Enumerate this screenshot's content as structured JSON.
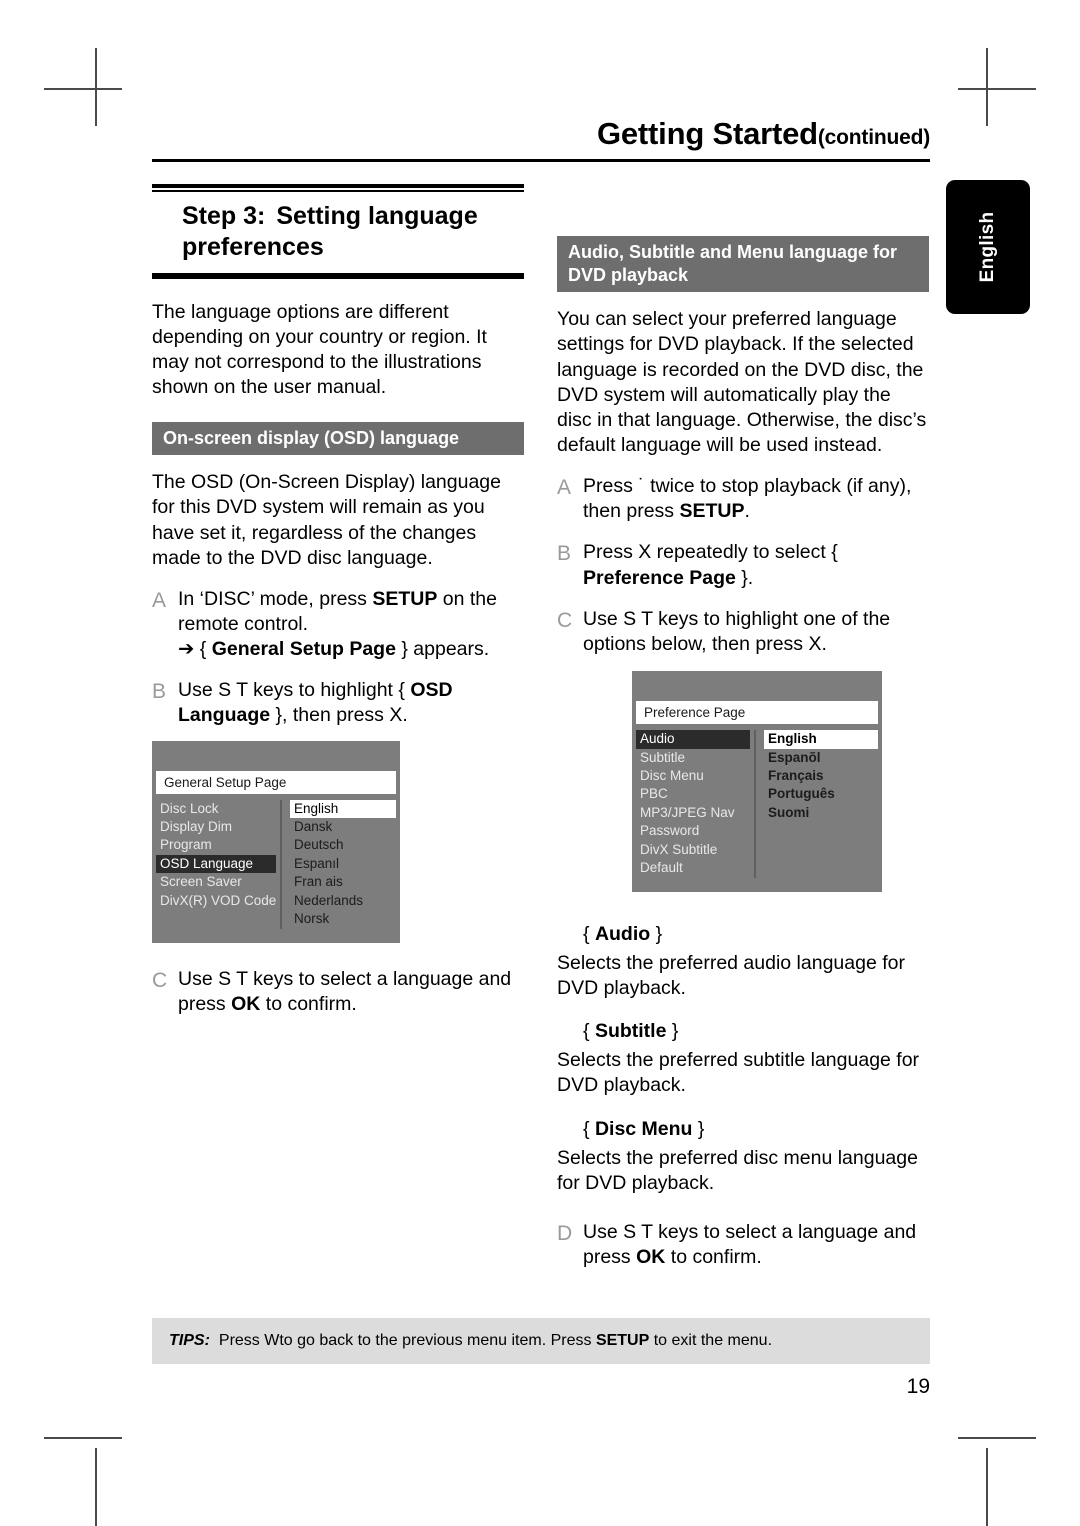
{
  "header": {
    "title": "Getting Started",
    "continued": "(continued)"
  },
  "side_tab": {
    "label": "English"
  },
  "left_column": {
    "step_title": {
      "number": "Step 3:",
      "text": "Setting language preferences"
    },
    "intro": "The language options are different depending on your country or region.  It may not correspond to the illustrations shown on the user manual.",
    "section_heading": "On-screen display (OSD) language",
    "section_body": "The OSD (On-Screen Display) language for this DVD system will remain as you have set it, regardless of the changes made to the DVD disc language.",
    "steps": [
      {
        "letter": "A",
        "line1_pre": "In ‘DISC’ mode, press ",
        "line1_bold": "SETUP",
        "line1_post": " on the remote control.",
        "arrow": "➔",
        "arrow_pre": " { ",
        "arrow_bold": "General Setup Page",
        "arrow_post": " } appears."
      },
      {
        "letter": "B",
        "pre": "Use  S T keys to highlight { ",
        "bold": "OSD Language",
        "post": " }, then press  X."
      },
      {
        "letter": "C",
        "pre": "Use  S T keys to select a language and press ",
        "bold": "OK",
        "post": " to confirm."
      }
    ],
    "osd_screen": {
      "title": "General Setup Page",
      "menu_items": [
        "Disc Lock",
        "Display Dim",
        "Program",
        "OSD Language",
        "Screen Saver",
        "DivX(R) VOD Code"
      ],
      "selected_menu_item": "OSD Language",
      "options": [
        "English",
        "Dansk",
        "Deutsch",
        "Espanıl",
        "Fran ais",
        "Nederlands",
        "Norsk"
      ],
      "selected_option": "English"
    }
  },
  "right_column": {
    "section_heading": "Audio, Subtitle and Menu language for DVD playback",
    "section_body": "You can select your preferred language settings for DVD playback.  If the selected language is recorded on the DVD disc, the DVD system will automatically play the disc in that language.  Otherwise, the disc’s default language will be used instead.",
    "steps": [
      {
        "letter": "A",
        "pre": "Press ˙   twice to stop playback (if any), then press ",
        "bold": "SETUP",
        "post": "."
      },
      {
        "letter": "B",
        "pre": "Press  X repeatedly to select { ",
        "bold": "Preference Page",
        "post": " }."
      },
      {
        "letter": "C",
        "pre": "Use  S T keys to highlight one of the options below, then press  X.",
        "bold": "",
        "post": ""
      }
    ],
    "osd_screen": {
      "title": "Preference Page",
      "menu_items": [
        "Audio",
        "Subtitle",
        "Disc Menu",
        "PBC",
        "MP3/JPEG Nav",
        "Password",
        "DivX Subtitle",
        "Default"
      ],
      "selected_menu_item": "Audio",
      "options": [
        "English",
        "Espanõl",
        "Français",
        "Português",
        "Suomi"
      ],
      "selected_option": "English"
    },
    "definitions": [
      {
        "term": "Audio",
        "desc": "Selects the preferred audio language for DVD playback."
      },
      {
        "term": "Subtitle",
        "desc": "Selects the preferred subtitle language for DVD playback."
      },
      {
        "term": "Disc Menu",
        "desc": "Selects the preferred disc menu language for DVD playback."
      }
    ],
    "step_d": {
      "letter": "D",
      "pre": "Use  S T keys to select a language and press ",
      "bold": "OK",
      "post": " to confirm."
    }
  },
  "tips": {
    "label": "TIPS:",
    "pre": "Press  Wto go back to the previous menu item.  Press ",
    "bold": "SETUP",
    "post": " to exit the menu."
  },
  "page_number": "19",
  "colors": {
    "section_heading_bg": "#6e6e6e",
    "osd_bg": "#7d7d7d",
    "osd_selected": "#2b2b2b",
    "tips_bg": "#dcdcdc",
    "tab_bg": "#000000"
  }
}
